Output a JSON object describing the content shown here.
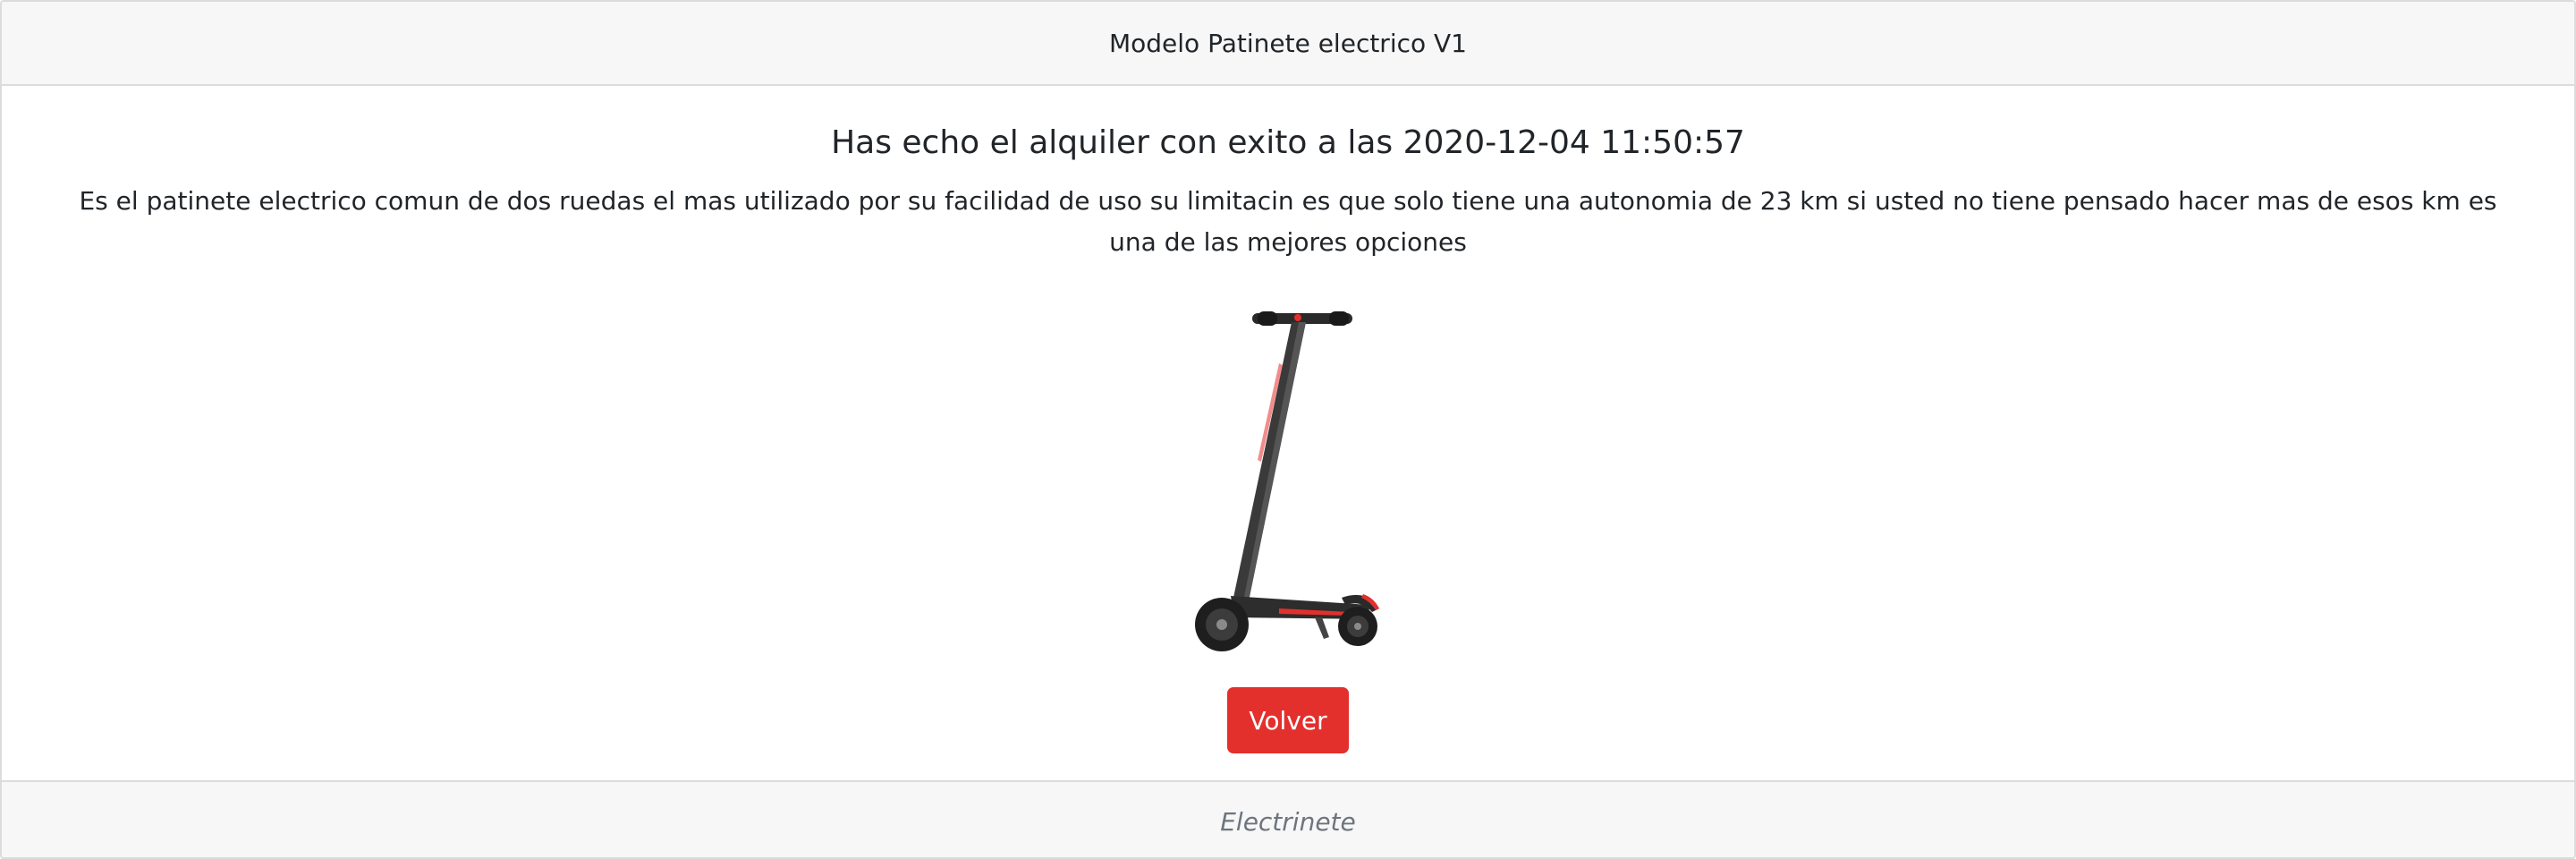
{
  "header": {
    "title": "Modelo Patinete electrico V1"
  },
  "main": {
    "heading": "Has echo el alquiler con exito a las 2020-12-04 11:50:57",
    "description": "Es el patinete electrico comun de dos ruedas el mas utilizado por su facilidad de uso su limitacin es que solo tiene una autonomia de 23 km si usted no tiene pensado hacer mas de esos km es una de las mejores opciones",
    "image_icon": "electric-scooter-image",
    "back_button_label": "Volver"
  },
  "footer": {
    "brand": "Electrinete"
  },
  "colors": {
    "button": "#e3302d",
    "header_bg": "#f7f7f7",
    "border": "#dcdcdc"
  }
}
